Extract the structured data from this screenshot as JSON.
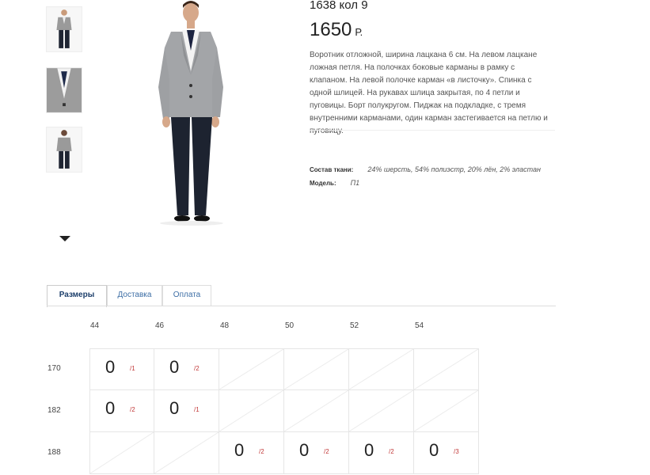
{
  "product": {
    "title": "1638 кол 9",
    "price": "1650",
    "currency": "Р.",
    "description": "Воротник отложной, ширина лацкана 6 см. На левом лацкане ложная петля. На полочках боковые карманы в рамку с клапаном. На левой полочке карман «в листочку». Спинка с одной шлицей. На рукавах шлица закрытая, по 4 петли и пуговицы. Борт полукругом. Пиджак на подкладке, с тремя внутренними карманами, один карман застегивается на петлю и пуговицу.",
    "fabric_label": "Состав ткани:",
    "fabric_value": "24% шерсть, 54% полиэстр, 20% лён, 2% эластан",
    "model_label": "Модель:",
    "model_value": "П1"
  },
  "thumbnails": [
    {
      "icon": "suit-front-photo"
    },
    {
      "icon": "suit-detail-photo"
    },
    {
      "icon": "suit-back-photo"
    }
  ],
  "tabs": [
    {
      "label": "Размеры",
      "active": true
    },
    {
      "label": "Доставка",
      "active": false
    },
    {
      "label": "Оплата",
      "active": false
    }
  ],
  "sizes": {
    "columns": [
      "44",
      "46",
      "48",
      "50",
      "52",
      "54"
    ],
    "rows": [
      {
        "height": "170",
        "cells": [
          {
            "value": "0",
            "note": "/1"
          },
          {
            "value": "0",
            "note": "/2"
          },
          null,
          null,
          null,
          null
        ]
      },
      {
        "height": "182",
        "cells": [
          {
            "value": "0",
            "note": "/2"
          },
          {
            "value": "0",
            "note": "/1"
          },
          null,
          null,
          null,
          null
        ]
      },
      {
        "height": "188",
        "cells": [
          null,
          null,
          {
            "value": "0",
            "note": "/2"
          },
          {
            "value": "0",
            "note": "/2"
          },
          {
            "value": "0",
            "note": "/2"
          },
          {
            "value": "0",
            "note": "/3"
          }
        ]
      }
    ]
  },
  "colors": {
    "tab_text": "#3d6ea5",
    "note_red": "#c23a3a"
  }
}
